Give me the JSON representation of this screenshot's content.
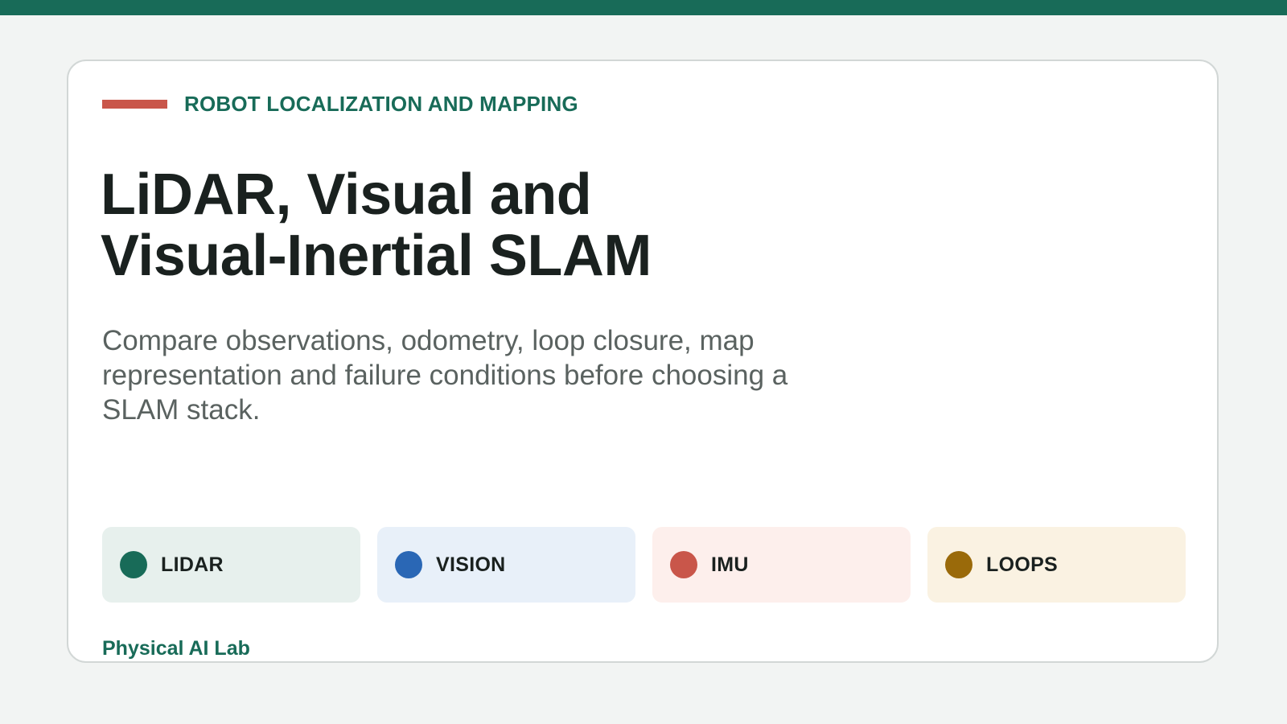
{
  "eyebrow": "ROBOT LOCALIZATION AND MAPPING",
  "title": "LiDAR, Visual and\nVisual-Inertial SLAM",
  "subtitle": "Compare observations, odometry, loop closure, map representation and failure conditions before choosing a SLAM stack.",
  "tags": [
    {
      "label": "LIDAR",
      "dot_color": "#186b58",
      "bg_color": "#e7f0ed"
    },
    {
      "label": "VISION",
      "dot_color": "#2a67b5",
      "bg_color": "#e8f0f9"
    },
    {
      "label": "IMU",
      "dot_color": "#c9564a",
      "bg_color": "#fdefec"
    },
    {
      "label": "LOOPS",
      "dot_color": "#9a6a0a",
      "bg_color": "#faf2e2"
    }
  ],
  "footer": "Physical AI Lab",
  "colors": {
    "accent": "#186b58",
    "rule": "#c9564a",
    "background": "#f2f4f3"
  }
}
